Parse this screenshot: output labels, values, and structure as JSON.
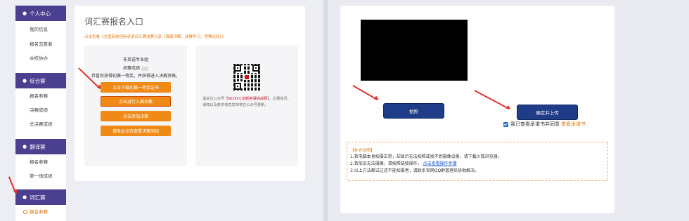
{
  "sidebar": {
    "sections": [
      {
        "label": "个人中心",
        "items": [
          "我的信息",
          "报名志愿者",
          "本校协办"
        ]
      },
      {
        "label": "综合赛",
        "items": [
          "报名参赛",
          "决赛成绩",
          "总决赛成绩"
        ]
      },
      {
        "label": "翻译赛",
        "items": [
          "报名参赛",
          "第一场成绩"
        ]
      },
      {
        "label": "词汇赛",
        "items": [
          "报名参赛"
        ]
      }
    ],
    "active_item": "报名参赛"
  },
  "main": {
    "title": "词汇赛报名入口",
    "note": "点击查看《全国高校创新英语词汇赛决赛分享（真题详解、决赛学习、竞赛经验）》",
    "panel_info": {
      "group": "非英语专业组",
      "score_label": "初赛成绩",
      "status": "恭喜你获得初赛一等奖，并获得进入决赛资格。"
    },
    "buttons": {
      "download_cert": "点击下载初赛一等奖证书",
      "join_group": "点击进行入赛须集",
      "join_final": "点击参加决赛",
      "final_notice": "请务必点击查看决赛须知"
    },
    "wechat_text_1": "请关注公众号【",
    "wechat_name": "NCIECC创新英语挑战赛",
    "wechat_text_2": "】，比赛资讯、通知以及获奖信息发布将在公众号更新。"
  },
  "upload": {
    "capture_button": "拍照",
    "submit_button": "确定并上传",
    "agree_text": "我已查看承诺书并同意",
    "agree_link": "查看承诺书",
    "notice_title": "【补充说明】",
    "notice_lines": [
      "1.若电脑本身拍摄正常，却显示无法拍照或找不到摄像设备，请下载火狐浏览器。",
      "2.若依旧无法摄像，请按照链接操作。",
      "3.以上方法都试过还不能拍摄者，请联系官网QQ群管理员协助解决。"
    ],
    "notice_link": "点击查看操作步骤"
  },
  "colors": {
    "sidebar_header": "#4b3f8f",
    "orange_button": "#f08a16",
    "blue_button": "#1f3c88",
    "accent_orange": "#e07a10",
    "arrow_red": "#e2312f"
  }
}
